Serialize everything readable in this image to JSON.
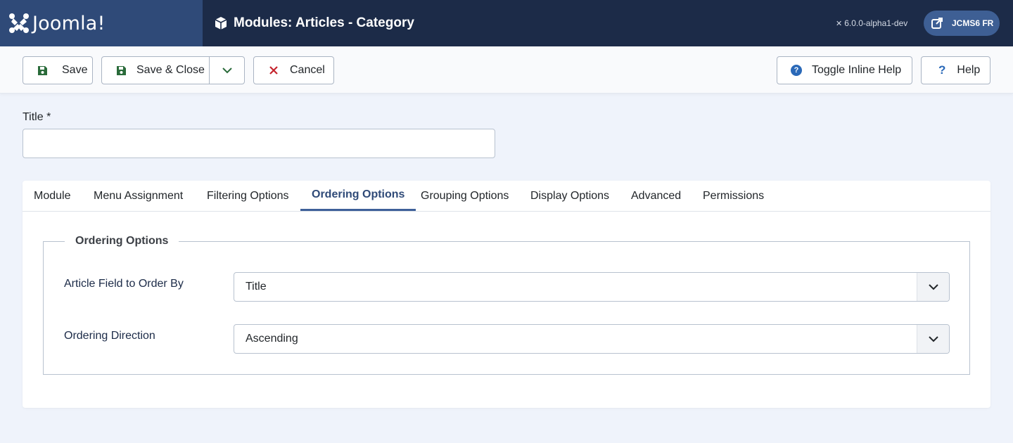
{
  "header": {
    "brand": "Joomla!",
    "title": "Modules: Articles - Category",
    "version": "6.0.0-alpha1-dev",
    "site_button": "JCMS6 FR"
  },
  "toolbar": {
    "save": "Save",
    "save_close": "Save & Close",
    "cancel": "Cancel",
    "toggle_inline_help": "Toggle Inline Help",
    "help": "Help"
  },
  "form": {
    "title_label": "Title *",
    "title_value": ""
  },
  "tabs": [
    {
      "label": "Module"
    },
    {
      "label": "Menu Assignment"
    },
    {
      "label": "Filtering Options"
    },
    {
      "label": "Ordering Options"
    },
    {
      "label": "Grouping Options"
    },
    {
      "label": "Display Options"
    },
    {
      "label": "Advanced"
    },
    {
      "label": "Permissions"
    }
  ],
  "active_tab": "Ordering Options",
  "ordering": {
    "legend": "Ordering Options",
    "field_to_order_label": "Article Field to Order By",
    "field_to_order_value": "Title",
    "direction_label": "Ordering Direction",
    "direction_value": "Ascending"
  },
  "colors": {
    "header_bg": "#1c2b48",
    "logo_bg": "#2f4a78",
    "accent": "#2f4a78",
    "save_icon": "#2a6b3a",
    "cancel_icon": "#c5242d",
    "help_icon": "#2a69b8"
  }
}
